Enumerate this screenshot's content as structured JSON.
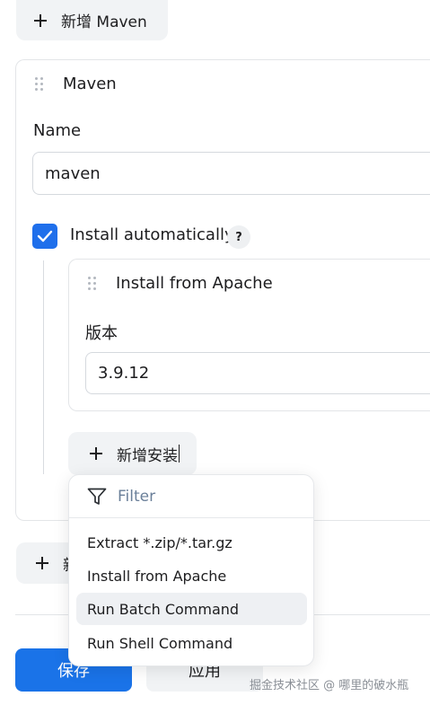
{
  "top_add_button": {
    "label": "新增 Maven"
  },
  "maven_card": {
    "title": "Maven",
    "name_label": "Name",
    "name_value": "maven",
    "install_auto_label": "Install automatically",
    "help_icon_text": "?",
    "installer_card": {
      "title": "Install from Apache",
      "version_label": "版本",
      "version_value": "3.9.12"
    },
    "add_installer_button": {
      "label": "新增安装"
    }
  },
  "dropdown": {
    "filter_placeholder": "Filter",
    "items": [
      {
        "label": "Extract *.zip/*.tar.gz"
      },
      {
        "label": "Install from Apache"
      },
      {
        "label": "Run Batch Command"
      },
      {
        "label": "Run Shell Command"
      }
    ]
  },
  "bottom_add_button": {
    "label": "新"
  },
  "footer": {
    "save_label": "保存",
    "apply_label": "应用"
  },
  "watermark": "掘金技术社区 @ 哪里的破水瓶",
  "colors": {
    "accent": "#1a73e8",
    "checkbox": "#1f6feb",
    "button_bg": "#f1f3f5",
    "filter_text": "#6a7f99"
  },
  "icons": {
    "add": "plus-icon",
    "drag": "drag-handle-icon",
    "check": "checkmark-icon",
    "help": "question-icon",
    "filter": "filter-funnel-icon"
  }
}
